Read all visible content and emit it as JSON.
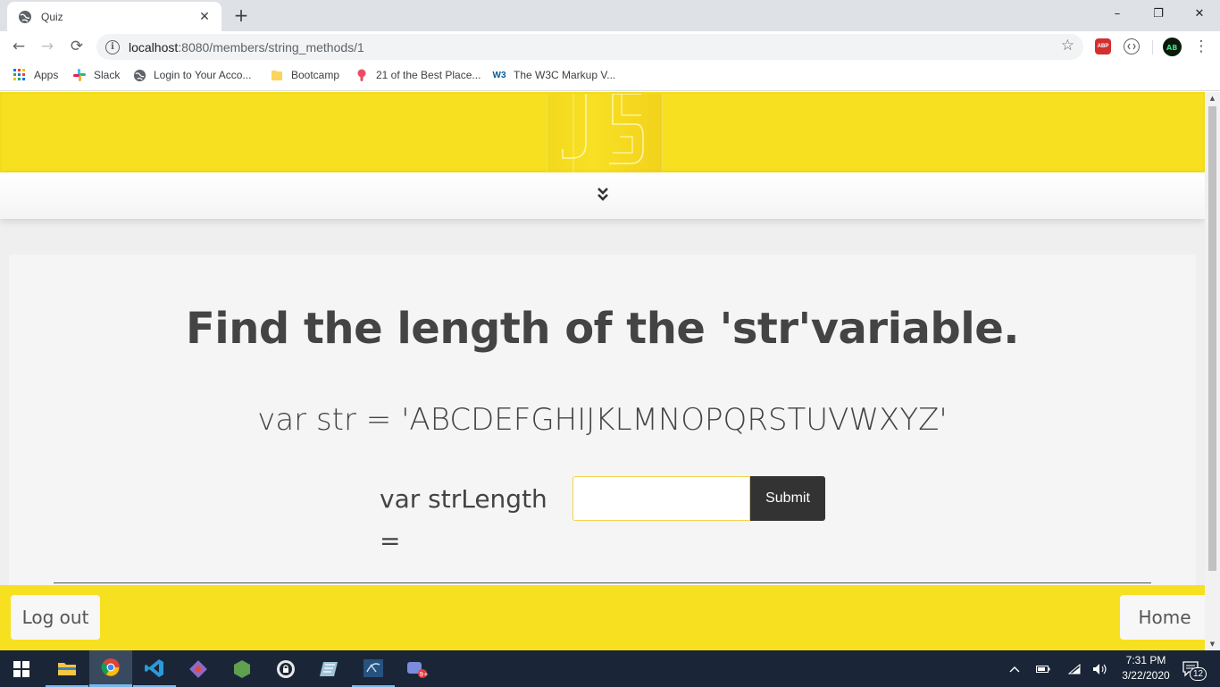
{
  "browser": {
    "tab": {
      "title": "Quiz",
      "favicon": "globe-icon",
      "close": "✕"
    },
    "new_tab": "+",
    "window_controls": {
      "minimize": "–",
      "restore": "❐",
      "close": "✕"
    },
    "toolbar": {
      "back": "←",
      "forward": "→",
      "reload": "⟳",
      "url_host": "localhost",
      "url_path": ":8080/members/string_methods/1",
      "star": "☆",
      "extensions": [
        "ABP",
        "extension-icon",
        "profile-avatar"
      ],
      "menu": "⋮"
    },
    "bookmarks": [
      {
        "label": "Apps",
        "icon": "apps-grid-icon"
      },
      {
        "label": "Slack",
        "icon": "slack-icon"
      },
      {
        "label": "Login to Your Acco...",
        "icon": "globe-icon"
      },
      {
        "label": "Bootcamp",
        "icon": "folder-icon"
      },
      {
        "label": "21 of the Best Place...",
        "icon": "pin-icon"
      },
      {
        "label": "The W3C Markup V...",
        "icon": "w3c-icon"
      }
    ]
  },
  "page": {
    "expand_icon": "double-chevron-down-icon",
    "question": "Find the length of the 'str'variable.",
    "code": "var str = 'ABCDEFGHIJKLMNOPQRSTUVWXYZ'",
    "answer_label": "var strLength =",
    "answer_value": "",
    "submit_label": "Submit",
    "footer": {
      "logout_label": "Log out",
      "home_label": "Home"
    },
    "colors": {
      "accent": "#f7e01f",
      "button": "#333333",
      "card": "#f5f5f5"
    }
  },
  "taskbar": {
    "apps": [
      "windows-start-icon",
      "file-explorer-icon",
      "chrome-icon",
      "vscode-icon",
      "git-icon",
      "node-icon",
      "vpn-icon",
      "notes-icon",
      "sql-icon",
      "chat-icon"
    ],
    "clock_time": "7:31 PM",
    "clock_date": "3/22/2020",
    "notifications": "12"
  }
}
